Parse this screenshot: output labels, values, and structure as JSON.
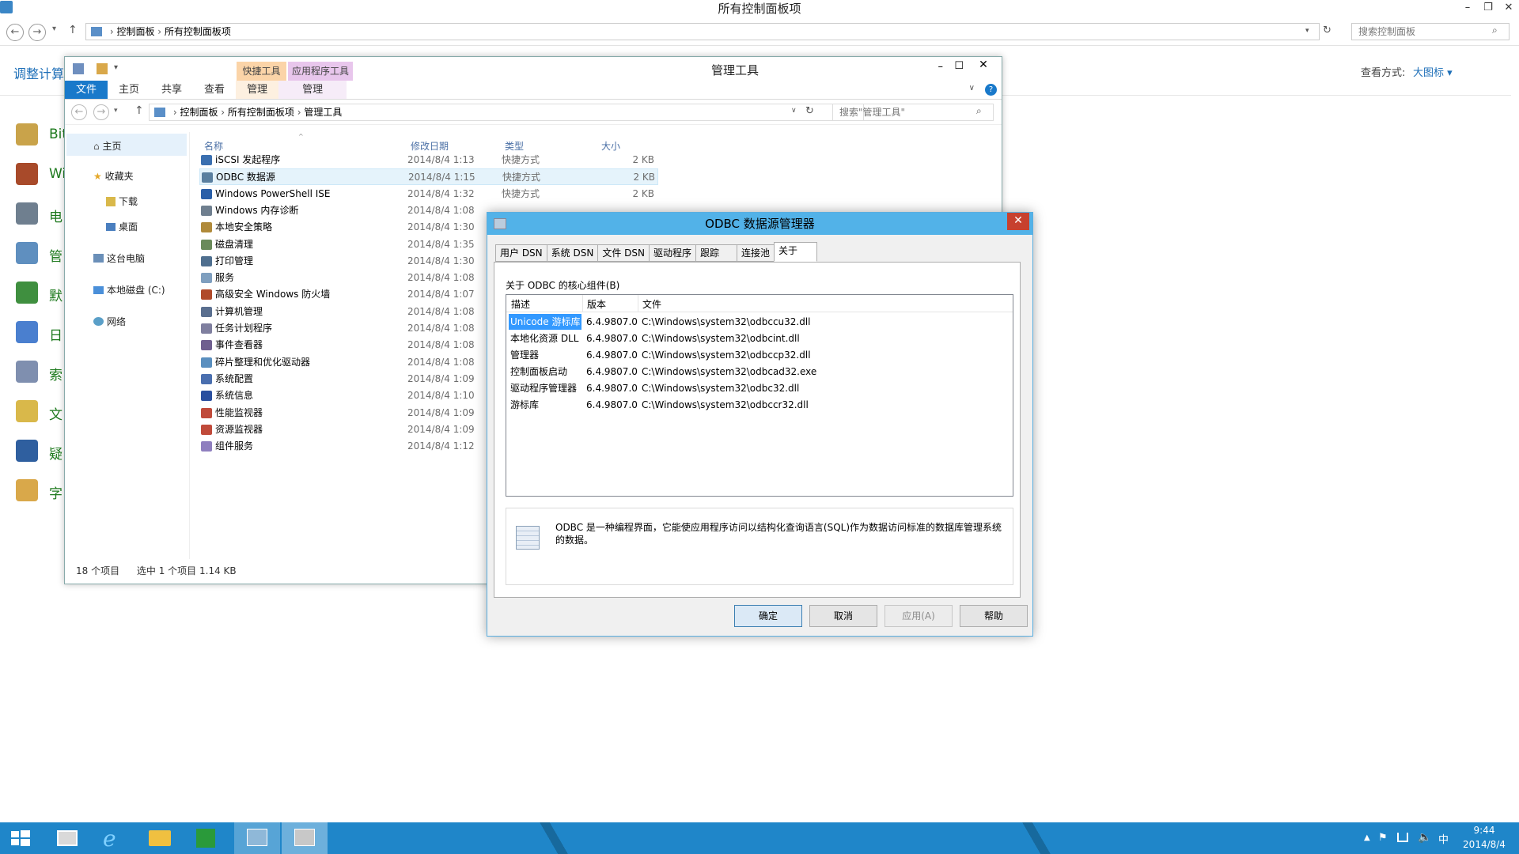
{
  "cp_window": {
    "title": "所有控制面板项",
    "breadcrumb": [
      "控制面板",
      "所有控制面板项"
    ],
    "search_placeholder": "搜索控制面板",
    "sidebar_heading": "调整计算",
    "view_label": "查看方式:",
    "view_value": "大图标 ▾",
    "items": [
      "Bit",
      "Wi",
      "电",
      "管",
      "默",
      "日",
      "索",
      "文",
      "疑",
      "字"
    ]
  },
  "tools_window": {
    "title": "管理工具",
    "context_tabs": [
      "快捷工具",
      "应用程序工具"
    ],
    "ribbon_tabs": [
      "文件",
      "主页",
      "共享",
      "查看",
      "管理",
      "管理"
    ],
    "breadcrumb": [
      "控制面板",
      "所有控制面板项",
      "管理工具"
    ],
    "search_placeholder": "搜索\"管理工具\"",
    "nav": [
      "主页",
      "收藏夹",
      "下载",
      "桌面",
      "这台电脑",
      "本地磁盘 (C:)",
      "网络"
    ],
    "columns": [
      "名称",
      "修改日期",
      "类型",
      "大小"
    ],
    "files": [
      {
        "name": "iSCSI 发起程序",
        "date": "2014/8/4 1:13",
        "type": "快捷方式",
        "size": "2 KB"
      },
      {
        "name": "ODBC 数据源",
        "date": "2014/8/4 1:15",
        "type": "快捷方式",
        "size": "2 KB"
      },
      {
        "name": "Windows PowerShell ISE",
        "date": "2014/8/4 1:32",
        "type": "快捷方式",
        "size": "2 KB"
      },
      {
        "name": "Windows 内存诊断",
        "date": "2014/8/4 1:08",
        "type": "",
        "size": ""
      },
      {
        "name": "本地安全策略",
        "date": "2014/8/4 1:30",
        "type": "",
        "size": ""
      },
      {
        "name": "磁盘清理",
        "date": "2014/8/4 1:35",
        "type": "",
        "size": ""
      },
      {
        "name": "打印管理",
        "date": "2014/8/4 1:30",
        "type": "",
        "size": ""
      },
      {
        "name": "服务",
        "date": "2014/8/4 1:08",
        "type": "",
        "size": ""
      },
      {
        "name": "高级安全 Windows 防火墙",
        "date": "2014/8/4 1:07",
        "type": "",
        "size": ""
      },
      {
        "name": "计算机管理",
        "date": "2014/8/4 1:08",
        "type": "",
        "size": ""
      },
      {
        "name": "任务计划程序",
        "date": "2014/8/4 1:08",
        "type": "",
        "size": ""
      },
      {
        "name": "事件查看器",
        "date": "2014/8/4 1:08",
        "type": "",
        "size": ""
      },
      {
        "name": "碎片整理和优化驱动器",
        "date": "2014/8/4 1:08",
        "type": "",
        "size": ""
      },
      {
        "name": "系统配置",
        "date": "2014/8/4 1:09",
        "type": "",
        "size": ""
      },
      {
        "name": "系统信息",
        "date": "2014/8/4 1:10",
        "type": "",
        "size": ""
      },
      {
        "name": "性能监视器",
        "date": "2014/8/4 1:09",
        "type": "",
        "size": ""
      },
      {
        "name": "资源监视器",
        "date": "2014/8/4 1:09",
        "type": "",
        "size": ""
      },
      {
        "name": "组件服务",
        "date": "2014/8/4 1:12",
        "type": "",
        "size": ""
      }
    ],
    "status_count": "18 个项目",
    "status_selected": "选中 1 个项目  1.14 KB"
  },
  "odbc_dialog": {
    "title": "ODBC 数据源管理器",
    "tabs": [
      "用户 DSN",
      "系统 DSN",
      "文件 DSN",
      "驱动程序",
      "跟踪",
      "连接池",
      "关于"
    ],
    "section_label": "关于 ODBC 的核心组件(B)",
    "columns": [
      "描述",
      "版本",
      "文件"
    ],
    "components": [
      {
        "desc": "Unicode 游标库",
        "version": "6.4.9807.0",
        "file": "C:\\Windows\\system32\\odbccu32.dll"
      },
      {
        "desc": "本地化资源 DLL",
        "version": "6.4.9807.0",
        "file": "C:\\Windows\\system32\\odbcint.dll"
      },
      {
        "desc": "管理器",
        "version": "6.4.9807.0",
        "file": "C:\\Windows\\system32\\odbccp32.dll"
      },
      {
        "desc": "控制面板启动",
        "version": "6.4.9807.0",
        "file": "C:\\Windows\\system32\\odbcad32.exe"
      },
      {
        "desc": "驱动程序管理器",
        "version": "6.4.9807.0",
        "file": "C:\\Windows\\system32\\odbc32.dll"
      },
      {
        "desc": "游标库",
        "version": "6.4.9807.0",
        "file": "C:\\Windows\\system32\\odbccr32.dll"
      }
    ],
    "info_text": "ODBC 是一种编程界面，它能使应用程序访问以结构化查询语言(SQL)作为数据访问标准的数据库管理系统的数据。",
    "buttons": [
      "确定",
      "取消",
      "应用(A)",
      "帮助"
    ]
  },
  "taskbar": {
    "time": "9:44",
    "date": "2014/8/4",
    "ime": "中"
  },
  "colors": {
    "accent": "#1f86c9",
    "dialog_title": "#52b2e8",
    "selection": "#3399ff",
    "link_blue": "#1e6fb8",
    "cp_green": "#1e7a1e"
  }
}
